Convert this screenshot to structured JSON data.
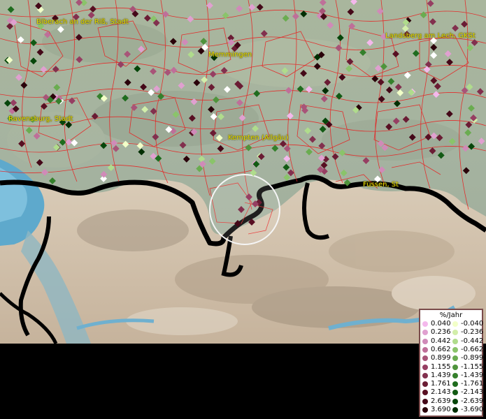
{
  "map": {
    "place_labels": [
      "Biberach an der Riß, Stadt",
      "Memmingen",
      "Landsberg am Lech, GKSt",
      "Ravensburg, Stadt",
      "Kempten (Allgäu)",
      "Füssen, St"
    ],
    "colors": {
      "positive": [
        "#f4b8ec",
        "#e0a0d0",
        "#d08ab8",
        "#bf6f99",
        "#a85478",
        "#963e62",
        "#82304e",
        "#6a1c34",
        "#580f22",
        "#440818",
        "#2a020a"
      ],
      "negative": [
        "#f2ffc8",
        "#d2eeaa",
        "#b0dc8c",
        "#8ac46a",
        "#6aac50",
        "#4f943c",
        "#35802c",
        "#1f6c1e",
        "#125a14",
        "#06460a",
        "#002e02"
      ],
      "border": "#e82020"
    }
  },
  "legend": {
    "title": "%/Jahr",
    "positive": [
      "0.040",
      "0.236",
      "0.442",
      "0.662",
      "0.899",
      "1.155",
      "1.439",
      "1.761",
      "2.143",
      "2.639",
      "3.690"
    ],
    "negative": [
      "-0.040",
      "-0.236",
      "-0.442",
      "-0.662",
      "-0.899",
      "-1.155",
      "-1.439",
      "-1.761",
      "-2.143",
      "-2.639",
      "-3.690"
    ]
  }
}
